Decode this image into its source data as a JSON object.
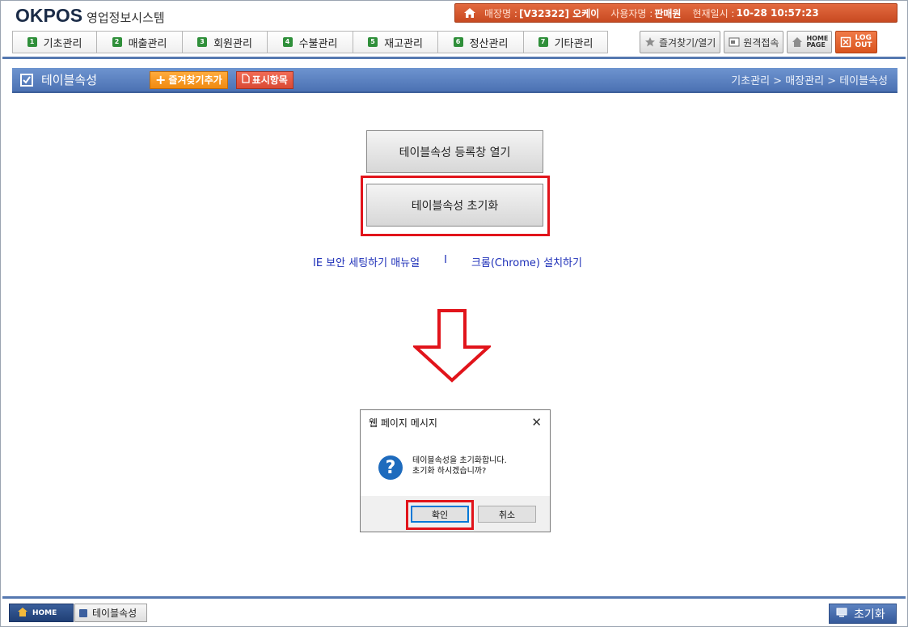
{
  "app": {
    "brand": "OKPOS",
    "subtitle": "영업정보시스템"
  },
  "infobar": {
    "store_label": "매장명 :",
    "store_value": "[V32322] 오케이",
    "user_label": "사용자명 :",
    "user_value": "판매원",
    "time_label": "현재일시 :",
    "time_value": "10-28 10:57:23"
  },
  "menu": [
    {
      "num": "1",
      "label": "기초관리"
    },
    {
      "num": "2",
      "label": "매출관리"
    },
    {
      "num": "3",
      "label": "회원관리"
    },
    {
      "num": "4",
      "label": "수불관리"
    },
    {
      "num": "5",
      "label": "재고관리"
    },
    {
      "num": "6",
      "label": "정산관리"
    },
    {
      "num": "7",
      "label": "기타관리"
    }
  ],
  "toolbar": {
    "favorites": "즐겨찾기/열기",
    "remote": "원격접속",
    "homepage": "HOME PAGE",
    "logout": "LOG OUT"
  },
  "title": {
    "page": "테이블속성",
    "fav_add": "즐겨찾기추가",
    "display_items": "표시항목",
    "breadcrumb": "기초관리 > 매장관리 > 테이블속성"
  },
  "main": {
    "open_button": "테이블속성 등록창 열기",
    "reset_button": "테이블속성 초기화",
    "link_ie": "IE 보안 세팅하기 매뉴얼",
    "link_sep": "I",
    "link_chrome": "크롬(Chrome) 설치하기"
  },
  "dialog": {
    "title": "웹 페이지 메시지",
    "message_line1": "테이블속성을 초기화합니다.",
    "message_line2": "초기화 하시겠습니까?",
    "ok": "확인",
    "cancel": "취소"
  },
  "footer": {
    "home": "HOME",
    "tab": "테이블속성",
    "reset": "초기화"
  },
  "colors": {
    "accent_orange": "#d9541e",
    "nav_blue": "#4b71b3",
    "highlight_red": "#e1141b"
  }
}
